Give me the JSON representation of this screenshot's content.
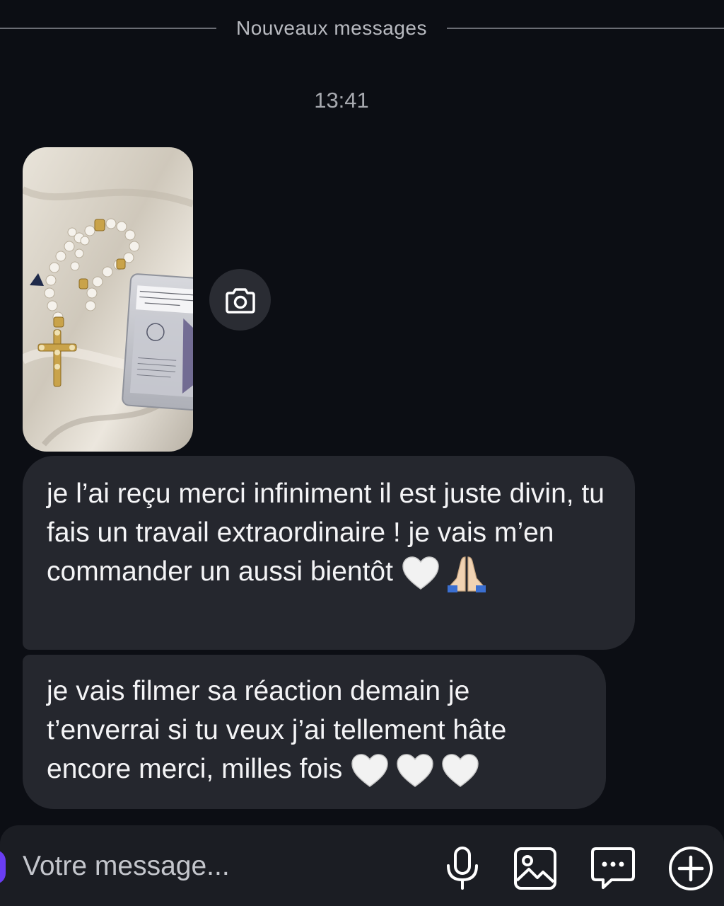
{
  "divider": {
    "label": "Nouveaux messages"
  },
  "timestamp": "13:41",
  "messages": [
    {
      "kind": "photo",
      "icon": "photo-thumbnail"
    },
    {
      "kind": "text",
      "text": "je l’ai reçu merci infiniment il est juste divin, tu fais un travail extraordinaire ! je vais m’en commander un aussi bientôt",
      "emojis": [
        "white-heart",
        "folded-hands"
      ]
    },
    {
      "kind": "text",
      "text": "je vais filmer sa réaction demain je t’enverrai si tu veux j’ai tellement hâte encore merci, milles fois",
      "emojis": [
        "white-heart",
        "white-heart",
        "white-heart"
      ]
    }
  ],
  "camera_button": {
    "icon": "camera-icon"
  },
  "composer": {
    "placeholder": "Votre message...",
    "tools": [
      "microphone-icon",
      "image-icon",
      "message-dots-icon",
      "add-circle-icon"
    ]
  },
  "colors": {
    "background": "#0c0e14",
    "bubble": "#25272e",
    "composer": "#1b1d23",
    "accent": "#6a3df2"
  }
}
